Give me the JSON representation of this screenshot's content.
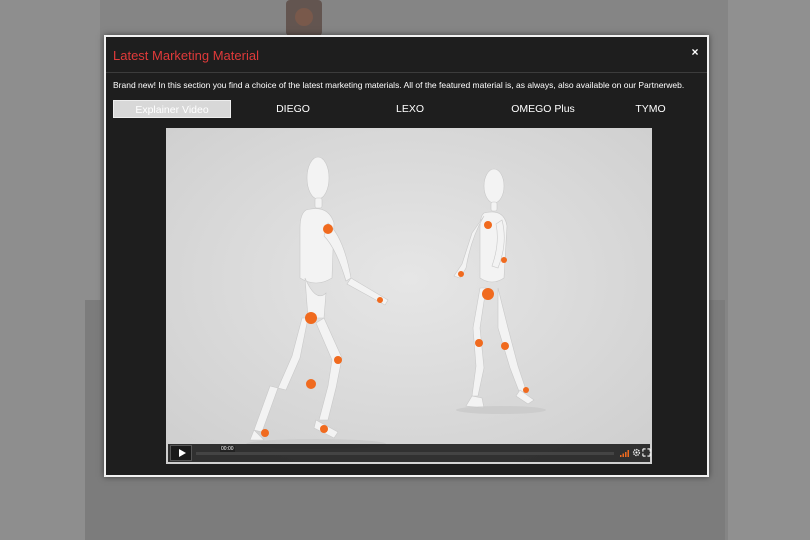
{
  "modal": {
    "title": "Latest Marketing Material",
    "close_label": "×",
    "intro": "Brand new! In this section you find a choice of the latest marketing materials. All of the featured material is, as always, also available on our Partnerweb."
  },
  "tabs": [
    {
      "label": "Explainer Video",
      "active": true
    },
    {
      "label": "DIEGO",
      "active": false
    },
    {
      "label": "LEXO",
      "active": false
    },
    {
      "label": "OMEGO Plus",
      "active": false
    },
    {
      "label": "TYMO",
      "active": false
    }
  ],
  "player": {
    "timecode": "00:00",
    "progress": 0,
    "icons": [
      "play-icon",
      "volume-icon",
      "settings-gear-icon",
      "fullscreen-icon"
    ]
  },
  "colors": {
    "title": "#e03a3a",
    "modal_bg": "#1e1e1e",
    "active_tab": "#d8d8d8",
    "accent_joint": "#f06a1e"
  }
}
